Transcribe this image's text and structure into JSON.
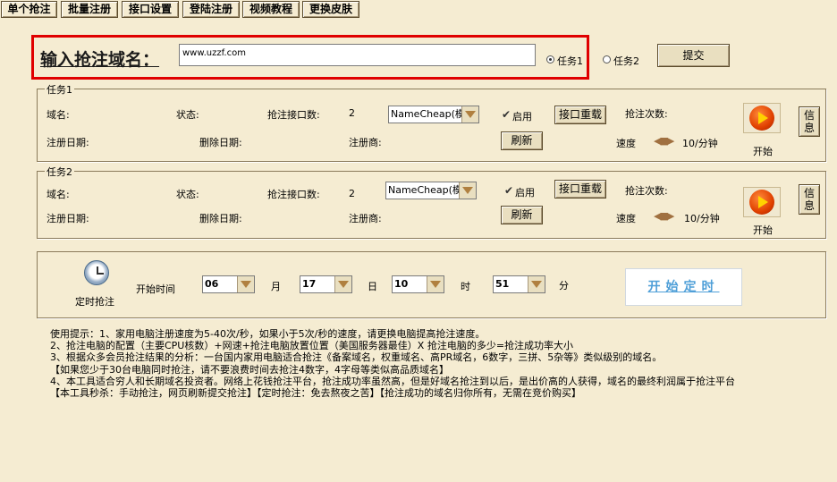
{
  "toolbar": {
    "single_grab": "单个抢注",
    "batch_register": "批量注册",
    "api_settings": "接口设置",
    "login_register": "登陆注册",
    "video_tutorial": "视频教程",
    "change_skin": "更换皮肤"
  },
  "domain_entry": {
    "label": "输入抢注域名：",
    "value": "www.uzzf.com",
    "radio_task1": "任务1",
    "radio_task2": "任务2",
    "selected_task": "任务1",
    "submit": "提交"
  },
  "task1": {
    "title": "任务1",
    "domain_label": "域名:",
    "status_label": "状态:",
    "api_count_label": "抢注接口数:",
    "api_count": "2",
    "registrar_combo": "NameCheap(模拟",
    "enable_label": "启用",
    "enabled": true,
    "reload_api": "接口重载",
    "grab_count_label": "抢注次数:",
    "reg_date_label": "注册日期:",
    "del_date_label": "删除日期:",
    "registrar_label": "注册商:",
    "refresh": "刷新",
    "speed_label": "速度",
    "speed_value": "10/分钟",
    "start_label": "开始",
    "info_button": "信息"
  },
  "task2": {
    "title": "任务2",
    "domain_label": "域名:",
    "status_label": "状态:",
    "api_count_label": "抢注接口数:",
    "api_count": "2",
    "registrar_combo": "NameCheap(模拟",
    "enable_label": "启用",
    "enabled": true,
    "reload_api": "接口重载",
    "grab_count_label": "抢注次数:",
    "reg_date_label": "注册日期:",
    "del_date_label": "删除日期:",
    "registrar_label": "注册商:",
    "refresh": "刷新",
    "speed_label": "速度",
    "speed_value": "10/分钟",
    "start_label": "开始",
    "info_button": "信息"
  },
  "timer": {
    "icon_label": "定时抢注",
    "start_time_label": "开始时间",
    "month_value": "06",
    "month_unit": "月",
    "day_value": "17",
    "day_unit": "日",
    "hour_value": "10",
    "hour_unit": "时",
    "minute_value": "51",
    "minute_unit": "分",
    "start_button": "开始定时"
  },
  "tips": [
    "使用提示：1、家用电脑注册速度为5-40次/秒，如果小于5次/秒的速度，请更换电脑提高抢注速度。",
    "2、抢注电脑的配置（主要CPU核数）+网速+抢注电脑放置位置（美国服务器最佳）X 抢注电脑的多少=抢注成功率大小",
    "3、根据众多会员抢注结果的分析：一台国内家用电脑适合抢注《备案域名，权重域名、高PR域名，6数字，三拼、5杂等》类似级别的域名。",
    "【如果您少于30台电脑同时抢注，请不要浪费时间去抢注4数字，4字母等类似高品质域名】",
    "4、本工具适合穷人和长期域名投资者。网络上花钱抢注平台，抢注成功率虽然高，但是好域名抢注到以后，是出价高的人获得，域名的最终利润属于抢注平台",
    "【本工具秒杀：手动抢注，网页刷新提交抢注】【定时抢注：免去熬夜之苦】【抢注成功的域名归你所有，无需在竞价购买】"
  ],
  "colors": {
    "background": "#f5ecd2",
    "highlight_border": "#e00000",
    "start_timer_text": "#4f9fd8"
  }
}
